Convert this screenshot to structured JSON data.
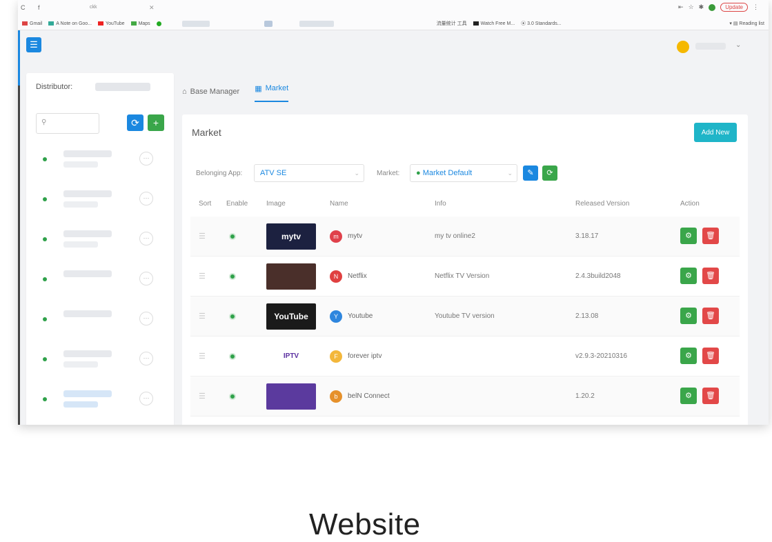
{
  "browser": {
    "tab_title": "ckk",
    "update_label": "Update",
    "bookmarks": [
      "Gmail",
      "A Note on Goo...",
      "YouTube",
      "Maps",
      "流量统计 工具",
      "Watch Free M...",
      "3.0 Standards..."
    ],
    "reading_list": "Reading list"
  },
  "sidebar": {
    "distributor_label": "Distributor:",
    "items": [
      {
        "status": "active"
      },
      {
        "status": "active"
      },
      {
        "status": "active"
      },
      {
        "status": "active"
      },
      {
        "status": "active"
      },
      {
        "status": "active"
      },
      {
        "status": "active"
      }
    ]
  },
  "breadcrumb": {
    "base_manager": "Base Manager",
    "market": "Market"
  },
  "market": {
    "title": "Market",
    "add_new": "Add New",
    "belonging_app_label": "Belonging App:",
    "belonging_app_value": "ATV SE",
    "market_label": "Market:",
    "market_value": "Market Default"
  },
  "table": {
    "headers": {
      "sort": "Sort",
      "enable": "Enable",
      "image": "Image",
      "name": "Name",
      "info": "Info",
      "released_version": "Released Version",
      "action": "Action"
    },
    "rows": [
      {
        "thumb": "mytv",
        "thumb_color": "#1c2140",
        "icon_letter": "m",
        "icon_color": "#e0414b",
        "name": "mytv",
        "info": "my tv online2",
        "version": "3.18.17"
      },
      {
        "thumb": "",
        "thumb_color": "#4a2f2a",
        "icon_letter": "N",
        "icon_color": "#e04040",
        "name": "Netflix",
        "info": "Netflix TV Version",
        "version": "2.4.3build2048"
      },
      {
        "thumb": "YouTube",
        "thumb_color": "#1a1a1a",
        "icon_letter": "Y",
        "icon_color": "#2e86de",
        "name": "Youtube",
        "info": "Youtube TV version",
        "version": "2.13.08"
      },
      {
        "thumb": "IPTV",
        "thumb_color": "#ffffff",
        "icon_letter": "F",
        "icon_color": "#f3b73b",
        "name": "forever iptv",
        "info": "",
        "version": "v2.9.3-20210316"
      },
      {
        "thumb": "",
        "thumb_color": "#5b3a9e",
        "icon_letter": "b",
        "icon_color": "#e6912b",
        "name": "belN Connect",
        "info": "",
        "version": "1.20.2"
      }
    ]
  },
  "caption": "Website",
  "colors": {
    "primary": "#1b88e0",
    "success": "#3aa64a",
    "danger": "#e24848",
    "teal": "#1fb5c8"
  }
}
